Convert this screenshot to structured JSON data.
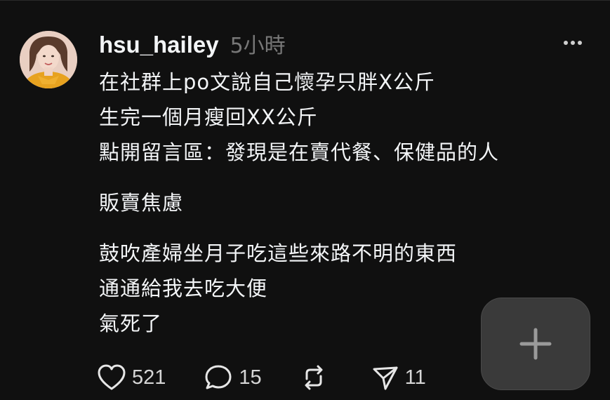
{
  "post": {
    "username": "hsu_hailey",
    "timestamp": "5小時",
    "lines": [
      "在社群上po文說自己懷孕只胖X公斤",
      "生完一個月瘦回XX公斤",
      "點開留言區：發現是在賣代餐、保健品的人",
      "販賣焦慮",
      "鼓吹產婦坐月子吃這些來路不明的東西",
      "通通給我去吃大便",
      "氣死了"
    ]
  },
  "actions": {
    "likes": "521",
    "comments": "15",
    "shares": "11"
  },
  "icons": {
    "more": "more-horizontal-icon",
    "like": "heart-icon",
    "comment": "comment-bubble-icon",
    "repost": "repost-icon",
    "share": "send-icon",
    "fab": "plus-icon"
  },
  "colors": {
    "background": "#101010",
    "text": "#f3f5f7",
    "muted": "#777777",
    "fab": "#3a3a3a"
  }
}
